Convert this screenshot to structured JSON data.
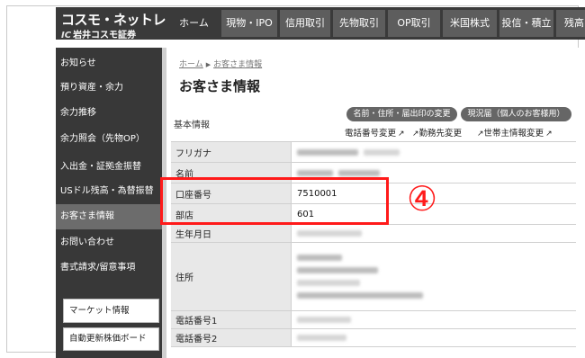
{
  "brand": {
    "name": "コスモ・ネットレ",
    "company_mark": "IC",
    "company": "岩井コスモ証券"
  },
  "nav": {
    "tabs": [
      {
        "label": "ホーム"
      },
      {
        "label": "現物・IPO"
      },
      {
        "label": "信用取引"
      },
      {
        "label": "先物取引"
      },
      {
        "label": "OP取引"
      },
      {
        "label": "米国株式"
      },
      {
        "label": "投信・積立"
      },
      {
        "label": "残高"
      }
    ]
  },
  "sidebar": {
    "items": [
      {
        "label": "お知らせ"
      },
      {
        "label": "預り資産・余力"
      },
      {
        "label": "余力推移"
      },
      {
        "label": "余力照会（先物OP）"
      },
      {
        "label": "入出金・証拠金振替"
      },
      {
        "label": "USドル残高・為替振替"
      },
      {
        "label": "お客さま情報"
      },
      {
        "label": "お問い合わせ"
      },
      {
        "label": "書式請求/留意事項"
      }
    ],
    "boxes": [
      {
        "label": "マーケット情報"
      },
      {
        "label": "自動更新株価ボード"
      }
    ]
  },
  "breadcrumb": {
    "home": "ホーム",
    "current": "お客さま情報"
  },
  "page": {
    "title": "お客さま情報",
    "section_label": "基本情報"
  },
  "actions": {
    "change_name_address_seal": "名前・住所・届出印の変更",
    "current_status_report": "現況届（個人のお客様用）",
    "change_phone": "電話番号変更",
    "change_workplace": "勤務先変更",
    "change_household_info": "世帯主情報変更"
  },
  "info_table": {
    "rows": [
      {
        "label": "フリガナ",
        "value": ""
      },
      {
        "label": "名前",
        "value": ""
      },
      {
        "label": "口座番号",
        "value": "7510001"
      },
      {
        "label": "部店",
        "value": "601"
      },
      {
        "label": "生年月日",
        "value": ""
      },
      {
        "label": "住所",
        "value": ""
      },
      {
        "label": "電話番号1",
        "value": ""
      },
      {
        "label": "電話番号2",
        "value": ""
      }
    ]
  },
  "annotation": {
    "step": "④",
    "color": "#ff1a1a"
  }
}
